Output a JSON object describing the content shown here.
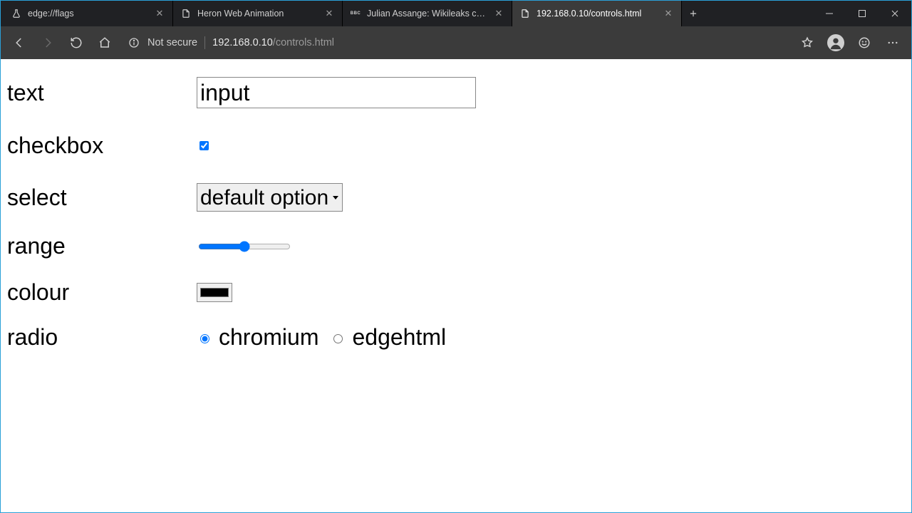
{
  "window": {
    "tabs": [
      {
        "title": "edge://flags",
        "favicon": "flask"
      },
      {
        "title": "Heron Web Animation",
        "favicon": "page"
      },
      {
        "title": "Julian Assange: Wikileaks co-fou",
        "favicon": "bbc"
      },
      {
        "title": "192.168.0.10/controls.html",
        "favicon": "page",
        "active": true
      }
    ]
  },
  "toolbar": {
    "not_secure": "Not secure",
    "url_host": "192.168.0.10",
    "url_path": "/controls.html"
  },
  "form": {
    "text_label": "text",
    "text_value": "input",
    "checkbox_label": "checkbox",
    "checkbox_checked": true,
    "select_label": "select",
    "select_value": "default option",
    "range_label": "range",
    "range_value": 50,
    "colour_label": "colour",
    "colour_value": "#000000",
    "radio_label": "radio",
    "radio_options": [
      {
        "label": "chromium",
        "checked": true
      },
      {
        "label": "edgehtml",
        "checked": false
      }
    ]
  }
}
